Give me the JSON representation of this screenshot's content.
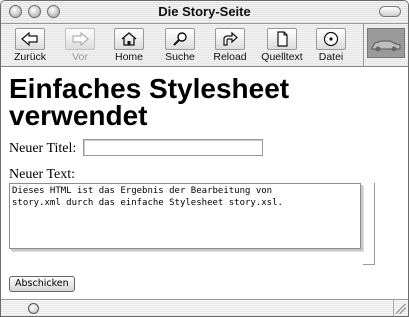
{
  "window": {
    "title": "Die Story-Seite"
  },
  "toolbar": {
    "buttons": [
      {
        "label": "Zurück",
        "icon": "back-arrow-icon",
        "enabled": true
      },
      {
        "label": "Vor",
        "icon": "forward-arrow-icon",
        "enabled": false
      },
      {
        "label": "Home",
        "icon": "home-icon",
        "enabled": true
      },
      {
        "label": "Suche",
        "icon": "search-icon",
        "enabled": true
      },
      {
        "label": "Reload",
        "icon": "reload-icon",
        "enabled": true
      },
      {
        "label": "Quelltext",
        "icon": "document-icon",
        "enabled": true
      },
      {
        "label": "Datei",
        "icon": "disk-icon",
        "enabled": true
      }
    ],
    "logo_icon": "car-logo-icon"
  },
  "page": {
    "heading": "Einfaches Stylesheet verwendet",
    "title_label": "Neuer Titel:",
    "title_value": "",
    "text_label": "Neuer Text:",
    "text_value": "Dieses HTML ist das Ergebnis der Bearbeitung von\nstory.xml durch das einfache Stylesheet story.xsl.",
    "submit_label": "Abschicken"
  }
}
